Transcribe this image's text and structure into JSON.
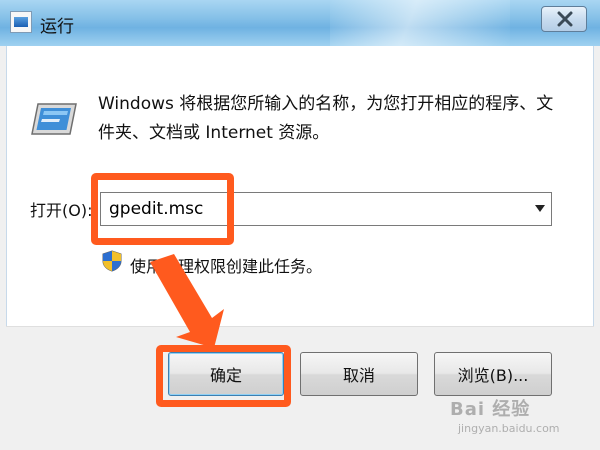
{
  "window": {
    "title": "运行",
    "title_icon": "run-dialog-icon",
    "close_icon": "close-icon"
  },
  "content": {
    "description": "Windows 将根据您所输入的名称，为您打开相应的程序、文件夹、文档或 Internet 资源。",
    "open_label": "打开(O):",
    "open_value": "gpedit.msc",
    "uac_text": "使用管理权限创建此任务。"
  },
  "buttons": {
    "ok": "确定",
    "cancel": "取消",
    "browse": "浏览(B)..."
  },
  "annotations": {
    "highlight_color": "#ff5a1e"
  },
  "watermark": {
    "text": "Bai 经验",
    "sub": "jingyan.baidu.com"
  }
}
